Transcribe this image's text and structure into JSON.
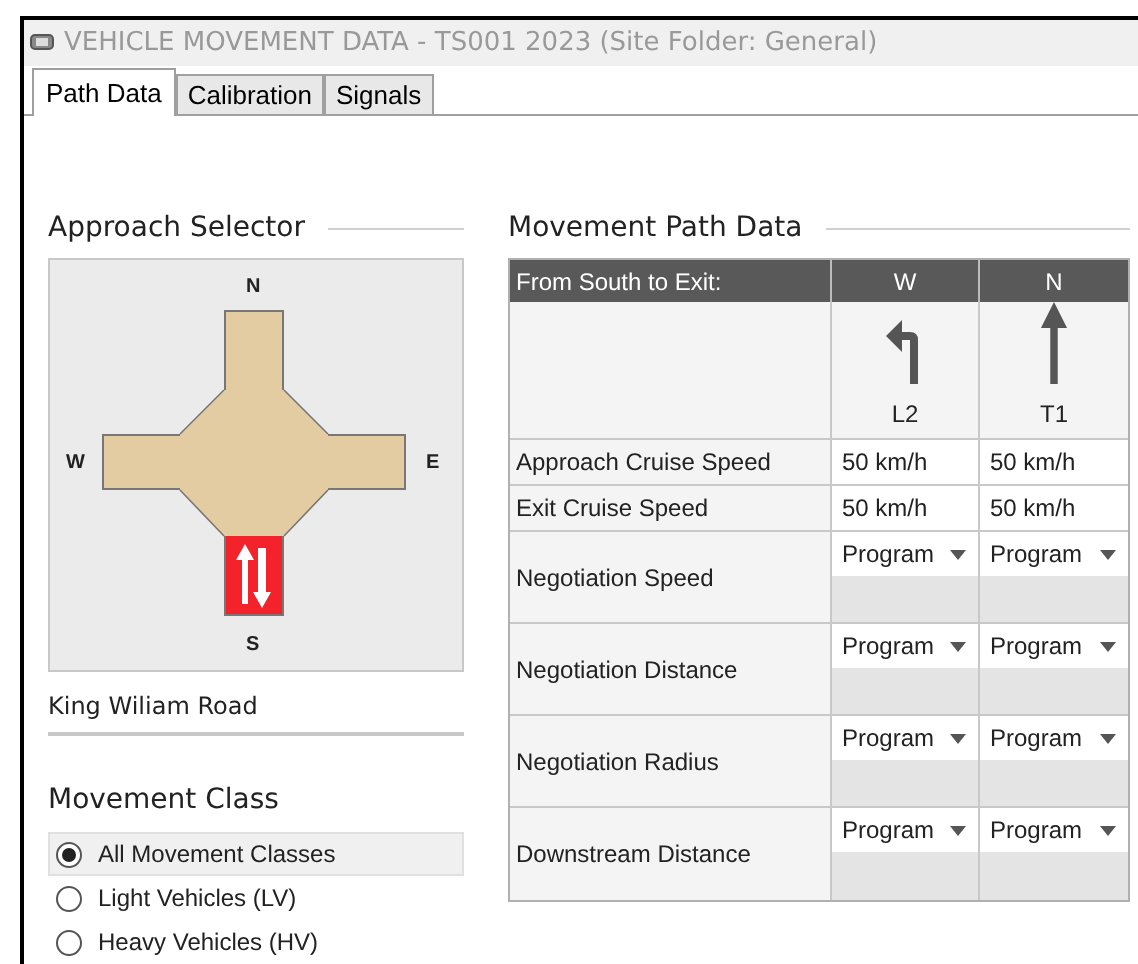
{
  "window": {
    "title": "VEHICLE MOVEMENT DATA - TS001 2023 (Site Folder: General)"
  },
  "tabs": [
    {
      "label": "Path Data",
      "selected": true
    },
    {
      "label": "Calibration",
      "selected": false
    },
    {
      "label": "Signals",
      "selected": false
    }
  ],
  "approach_selector": {
    "title": "Approach Selector",
    "approaches": [
      {
        "label": "N",
        "selected": false
      },
      {
        "label": "W",
        "selected": false
      },
      {
        "label": "E",
        "selected": false
      },
      {
        "label": "S",
        "selected": true
      }
    ],
    "road_name": "King Wiliam Road"
  },
  "movement_class": {
    "title": "Movement Class",
    "options": [
      {
        "label": "All Movement Classes",
        "selected": true
      },
      {
        "label": "Light Vehicles (LV)",
        "selected": false
      },
      {
        "label": "Heavy Vehicles (HV)",
        "selected": false
      }
    ]
  },
  "movement_path_data": {
    "title": "Movement Path Data",
    "header": "From South to Exit:",
    "movements": [
      {
        "exit": "W",
        "kind": "left",
        "code": "L2"
      },
      {
        "exit": "N",
        "kind": "through",
        "code": "T1"
      }
    ],
    "rows": [
      {
        "label": "Approach Cruise Speed",
        "kind": "value",
        "values": [
          "50 km/h",
          "50 km/h"
        ]
      },
      {
        "label": "Exit Cruise Speed",
        "kind": "value",
        "values": [
          "50 km/h",
          "50 km/h"
        ]
      },
      {
        "label": "Negotiation Speed",
        "kind": "dropdown",
        "values": [
          "Program",
          "Program"
        ]
      },
      {
        "label": "Negotiation Distance",
        "kind": "dropdown",
        "values": [
          "Program",
          "Program"
        ]
      },
      {
        "label": "Negotiation Radius",
        "kind": "dropdown",
        "values": [
          "Program",
          "Program"
        ]
      },
      {
        "label": "Downstream Distance",
        "kind": "dropdown",
        "values": [
          "Program",
          "Program"
        ]
      }
    ]
  }
}
